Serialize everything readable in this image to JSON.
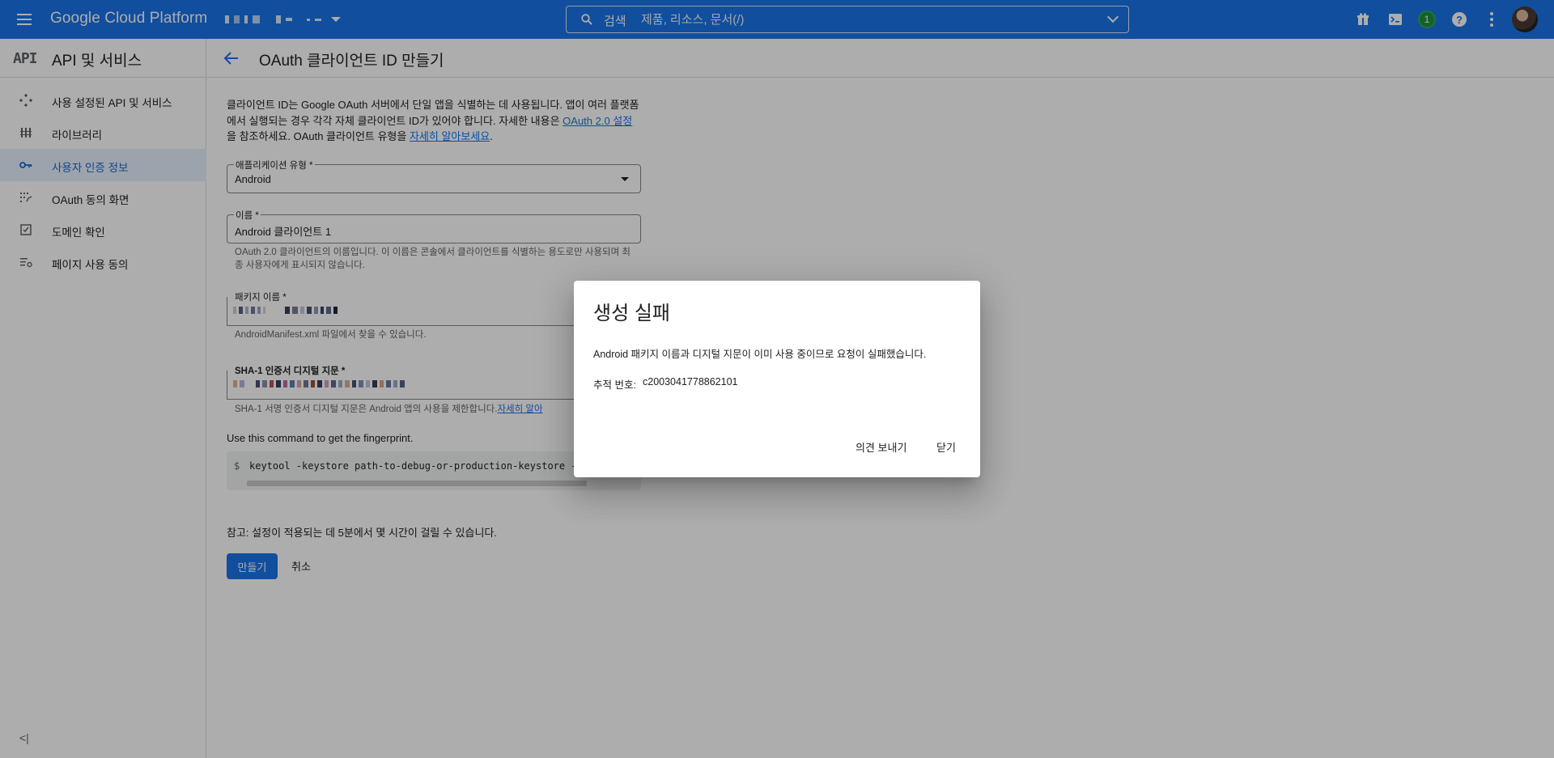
{
  "topbar": {
    "brand": "Google Cloud Platform",
    "search_prefix": "검색",
    "search_placeholder": "제품, 리소스, 문서(/)",
    "notification_count": "1",
    "help_glyph": "?"
  },
  "sidebar": {
    "logo": "API",
    "title": "API 및 서비스",
    "items": [
      {
        "label": "사용 설정된 API 및 서비스",
        "icon": "diamond-grid-icon"
      },
      {
        "label": "라이브러리",
        "icon": "library-icon"
      },
      {
        "label": "사용자 인증 정보",
        "icon": "key-icon"
      },
      {
        "label": "OAuth 동의 화면",
        "icon": "consent-grid-icon"
      },
      {
        "label": "도메인 확인",
        "icon": "checkbox-icon"
      },
      {
        "label": "페이지 사용 동의",
        "icon": "settings-list-icon"
      }
    ],
    "active_index": 2,
    "collapse_glyph": "<|"
  },
  "page": {
    "title": "OAuth 클라이언트 ID 만들기"
  },
  "form": {
    "intro_part1": "클라이언트 ID는 Google OAuth 서버에서 단일 앱을 식별하는 데 사용됩니다. 앱이 여러 플랫폼에서 실행되는 경우 각각 자체 클라이언트 ID가 있어야 합니다. 자세한 내용은 ",
    "intro_link1": "OAuth 2.0 설정",
    "intro_part2": "을 참조하세요. OAuth 클라이언트 유형을 ",
    "intro_link2": "자세히 알아보세요",
    "intro_part3": ".",
    "app_type_label": "애플리케이션 유형 *",
    "app_type_value": "Android",
    "name_label": "이름 *",
    "name_value": "Android 클라이언트 1",
    "name_hint": "OAuth 2.0 클라이언트의 이름입니다. 이 이름은 콘솔에서 클라이언트를 식별하는 용도로만 사용되며 최종 사용자에게 표시되지 않습니다.",
    "package_label": "패키지 이름 *",
    "package_hint": "AndroidManifest.xml 파일에서 찾을 수 있습니다.",
    "sha_label": "SHA-1 인증서 디지털 지문 *",
    "sha_hint_text": "SHA-1 서명 인증서 디지털 지문은 Android 앱의 사용을 제한합니다.",
    "sha_hint_link": "자세히 알아",
    "cmd_label": "Use this command to get the fingerprint.",
    "cmd_prompt": "$",
    "cmd_text": "keytool -keystore path-to-debug-or-production-keystore -",
    "note": "참고: 설정이 적용되는 데 5분에서 몇 시간이 걸릴 수 있습니다.",
    "create_button": "만들기",
    "cancel_button": "취소"
  },
  "dialog": {
    "title": "생성 실패",
    "message": "Android 패키지 이름과 디지털 지문이 이미 사용 중이므로 요청이 실패했습니다.",
    "trace_label": "추적 번호:",
    "trace_value": "c2003041778862101",
    "feedback_button": "의견 보내기",
    "close_button": "닫기"
  },
  "colors": {
    "brand_blue": "#1a73e8",
    "active_bg": "#e8f0fe",
    "active_text": "#1967d2",
    "badge_green": "#1e8e3e"
  }
}
